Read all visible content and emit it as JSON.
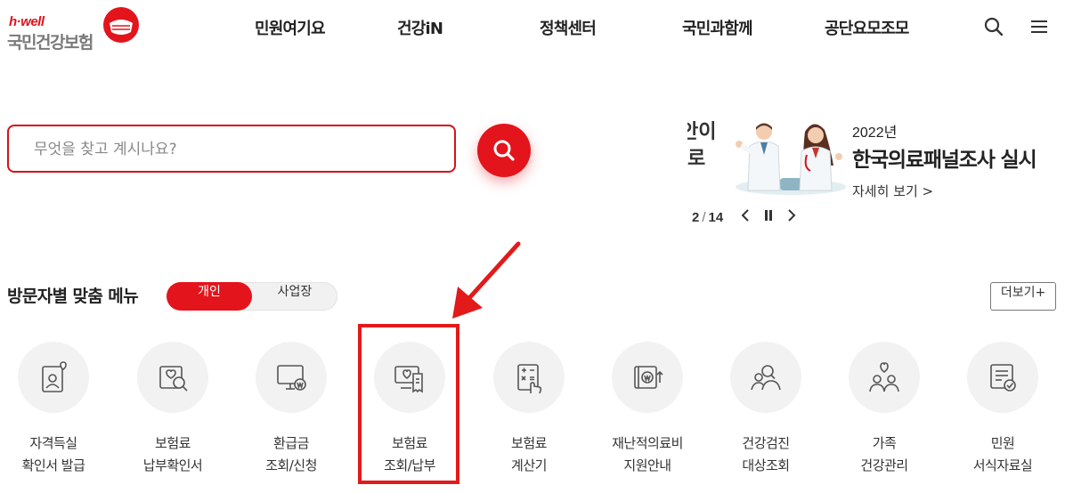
{
  "header": {
    "logo_tagline": "h·well",
    "logo_name": "국민건강보험",
    "nav": [
      "민원여기요",
      "건강iN",
      "정책센터",
      "국민과함께",
      "공단요모조모"
    ],
    "icons": {
      "search": "search-icon",
      "menu": "hamburger-menu-icon"
    }
  },
  "search": {
    "placeholder": "무엇을 찾고 계시나요?",
    "value": ""
  },
  "banner": {
    "prev_fragment_line1": "안이",
    "prev_fragment_line2": "로",
    "year": "2022년",
    "title": "한국의료패널조사 실시",
    "more": "자세히 보기 >",
    "current": "2",
    "separator": "/",
    "total": "14"
  },
  "section": {
    "title": "방문자별 맞춤 메뉴",
    "toggle": [
      "개인",
      "사업장"
    ],
    "selected": "개인",
    "more": "더보기+"
  },
  "menu": [
    {
      "line1": "자격득실",
      "line2": "확인서 발급",
      "icon": "id-card-heart-icon"
    },
    {
      "line1": "보험료",
      "line2": "납부확인서",
      "icon": "document-search-icon"
    },
    {
      "line1": "환급금",
      "line2": "조회/신청",
      "icon": "monitor-won-icon"
    },
    {
      "line1": "보험료",
      "line2": "조회/납부",
      "icon": "screen-bill-icon"
    },
    {
      "line1": "보험료",
      "line2": "계산기",
      "icon": "calculator-hand-icon"
    },
    {
      "line1": "재난적의료비",
      "line2": "지원안내",
      "icon": "won-support-icon"
    },
    {
      "line1": "건강검진",
      "line2": "대상조회",
      "icon": "people-search-icon"
    },
    {
      "line1": "가족",
      "line2": "건강관리",
      "icon": "family-heart-icon"
    },
    {
      "line1": "민원",
      "line2": "서식자료실",
      "icon": "form-check-icon"
    }
  ],
  "colors": {
    "brand_red": "#e3141c",
    "annotation_red": "#e31a1a"
  }
}
